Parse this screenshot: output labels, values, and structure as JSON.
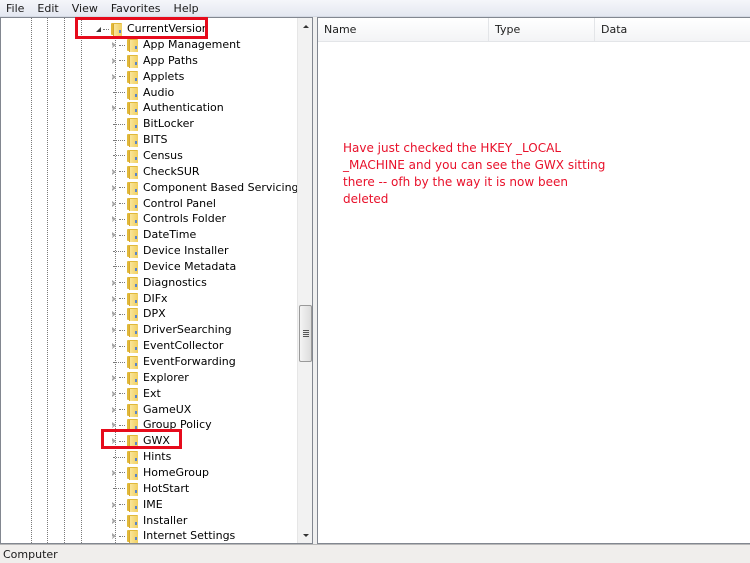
{
  "menu": {
    "items": [
      "File",
      "Edit",
      "View",
      "Favorites",
      "Help"
    ]
  },
  "tree": {
    "parent": {
      "label": "CurrentVersion",
      "expanded": true,
      "highlighted": true
    },
    "children": [
      {
        "label": "App Management",
        "expandable": true
      },
      {
        "label": "App Paths",
        "expandable": true
      },
      {
        "label": "Applets",
        "expandable": true
      },
      {
        "label": "Audio",
        "expandable": false
      },
      {
        "label": "Authentication",
        "expandable": true
      },
      {
        "label": "BitLocker",
        "expandable": false
      },
      {
        "label": "BITS",
        "expandable": false
      },
      {
        "label": "Census",
        "expandable": false
      },
      {
        "label": "CheckSUR",
        "expandable": true
      },
      {
        "label": "Component Based Servicing",
        "expandable": true
      },
      {
        "label": "Control Panel",
        "expandable": true
      },
      {
        "label": "Controls Folder",
        "expandable": true
      },
      {
        "label": "DateTime",
        "expandable": true
      },
      {
        "label": "Device Installer",
        "expandable": false
      },
      {
        "label": "Device Metadata",
        "expandable": false
      },
      {
        "label": "Diagnostics",
        "expandable": true
      },
      {
        "label": "DIFx",
        "expandable": true
      },
      {
        "label": "DPX",
        "expandable": true
      },
      {
        "label": "DriverSearching",
        "expandable": true
      },
      {
        "label": "EventCollector",
        "expandable": true
      },
      {
        "label": "EventForwarding",
        "expandable": false
      },
      {
        "label": "Explorer",
        "expandable": true
      },
      {
        "label": "Ext",
        "expandable": true
      },
      {
        "label": "GameUX",
        "expandable": true
      },
      {
        "label": "Group Policy",
        "expandable": true
      },
      {
        "label": "GWX",
        "expandable": true,
        "highlighted": true
      },
      {
        "label": "Hints",
        "expandable": false
      },
      {
        "label": "HomeGroup",
        "expandable": true
      },
      {
        "label": "HotStart",
        "expandable": false
      },
      {
        "label": "IME",
        "expandable": true
      },
      {
        "label": "Installer",
        "expandable": true
      },
      {
        "label": "Internet Settings",
        "expandable": true
      }
    ]
  },
  "list": {
    "columns": [
      "Name",
      "Type",
      "Data"
    ]
  },
  "annotation": {
    "text": "Have just checked the HKEY _LOCAL _MACHINE and you can see the GWX sitting there -- ofh by the way it is now been deleted",
    "color": "#e8102a"
  },
  "status_bar": {
    "path": "Computer"
  },
  "colors": {
    "highlight_box": "#e60b1c"
  }
}
